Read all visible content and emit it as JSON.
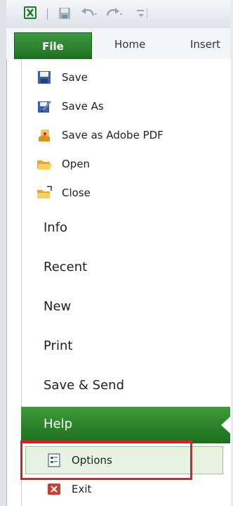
{
  "tabs": {
    "file": "File",
    "home": "Home",
    "insert": "Insert"
  },
  "menu": {
    "commands": [
      "Save",
      "Save As",
      "Save as Adobe PDF",
      "Open",
      "Close"
    ],
    "sections": [
      "Info",
      "Recent",
      "New",
      "Print",
      "Save & Send"
    ],
    "help": "Help",
    "options": "Options",
    "exit": "Exit"
  },
  "colors": {
    "accent_green": "#2a7d2a",
    "highlight_red": "#e51c23"
  },
  "icons": [
    "excel-icon",
    "save-icon",
    "undo-icon",
    "redo-icon",
    "customize-qat-icon",
    "save-as-icon",
    "adobe-pdf-icon",
    "open-folder-icon",
    "close-folder-icon",
    "options-icon",
    "exit-icon"
  ]
}
